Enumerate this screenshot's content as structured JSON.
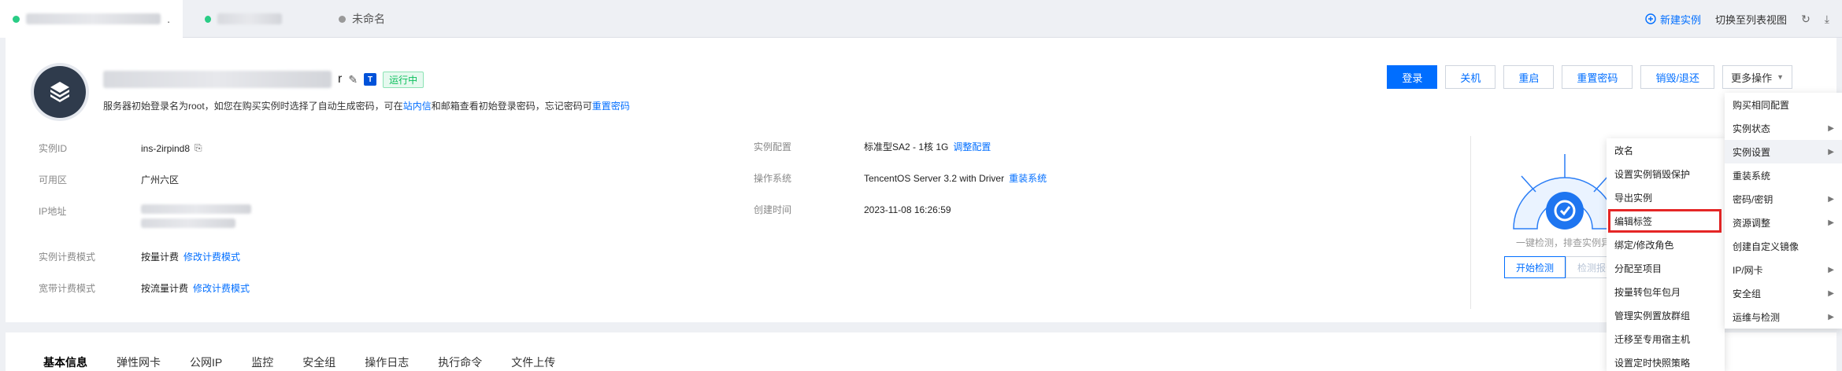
{
  "topbar": {
    "tabs": [
      {
        "label": ".",
        "status": "running"
      },
      {
        "label": "",
        "status": "running"
      },
      {
        "label": "未命名",
        "status": "default"
      }
    ],
    "new_instance": "新建实例",
    "switch_view": "切换至列表视图"
  },
  "instance": {
    "name_tail": "r",
    "status": "运行中",
    "hint_pre": "服务器初始登录名为root，如您在购买实例时选择了自动生成密码，可在",
    "hint_link1": "站内信",
    "hint_mid": "和邮箱查看初始登录密码，忘记密码可",
    "hint_link2": "重置密码"
  },
  "actions": {
    "login": "登录",
    "shutdown": "关机",
    "restart": "重启",
    "reset_password": "重置密码",
    "terminate": "销毁/退还",
    "more": "更多操作"
  },
  "info": {
    "instance_id_label": "实例ID",
    "instance_id": "ins-2irpind8",
    "zone_label": "可用区",
    "zone": "广州六区",
    "ip_label": "IP地址",
    "billing_label": "实例计费模式",
    "billing": "按量计费",
    "billing_link": "修改计费模式",
    "bandwidth_label": "宽带计费模式",
    "bandwidth": "按流量计费",
    "bandwidth_link": "修改计费模式",
    "config_label": "实例配置",
    "config": "标准型SA2 - 1核 1G",
    "config_link": "调整配置",
    "os_label": "操作系统",
    "os": "TencentOS Server 3.2 with Driver",
    "os_link": "重装系统",
    "created_label": "创建时间",
    "created": "2023-11-08 16:26:59"
  },
  "health": {
    "caption": "一键检测，排查实例异常",
    "start": "开始检测",
    "report": "检测报告"
  },
  "lower_tabs": [
    "基本信息",
    "弹性网卡",
    "公网IP",
    "监控",
    "安全组",
    "操作日志",
    "执行命令",
    "文件上传"
  ],
  "main_menu": [
    {
      "label": "购买相同配置",
      "sub": false
    },
    {
      "label": "实例状态",
      "sub": true
    },
    {
      "label": "实例设置",
      "sub": true
    },
    {
      "label": "重装系统",
      "sub": false
    },
    {
      "label": "密码/密钥",
      "sub": true
    },
    {
      "label": "资源调整",
      "sub": true
    },
    {
      "label": "创建自定义镜像",
      "sub": false
    },
    {
      "label": "IP/网卡",
      "sub": true
    },
    {
      "label": "安全组",
      "sub": true
    },
    {
      "label": "运维与检测",
      "sub": true
    }
  ],
  "sub_menu": [
    "改名",
    "设置实例销毁保护",
    "导出实例",
    "编辑标签",
    "绑定/修改角色",
    "分配至项目",
    "按量转包年包月",
    "管理实例置放群组",
    "迁移至专用宿主机",
    "设置定时快照策略"
  ],
  "colors": {
    "primary": "#006eff",
    "running": "#0abf5b",
    "highlight": "#e52626"
  }
}
